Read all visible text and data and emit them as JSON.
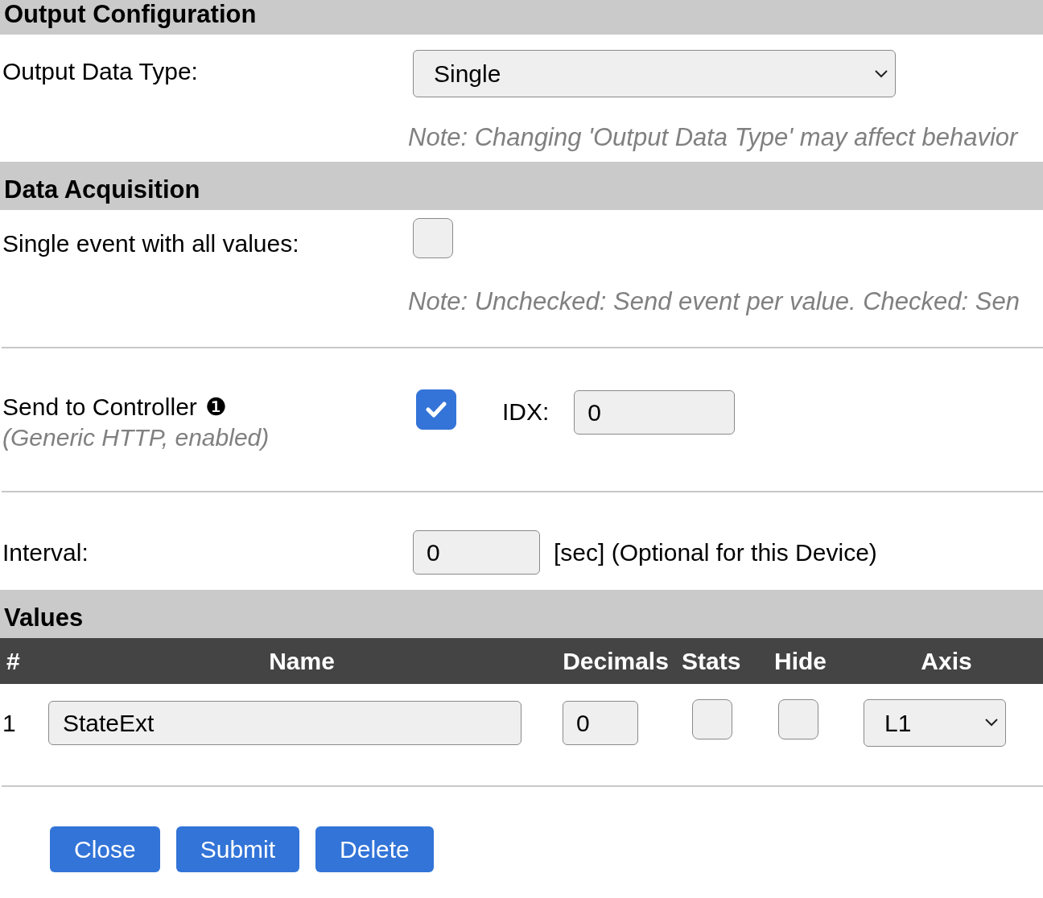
{
  "output_configuration": {
    "title": "Output Configuration",
    "output_data_type": {
      "label": "Output Data Type:",
      "value": "Single",
      "note": "Note: Changing 'Output Data Type' may affect behavior"
    }
  },
  "data_acquisition": {
    "title": "Data Acquisition",
    "single_event": {
      "label": "Single event with all values:",
      "checked": false,
      "note": "Note: Unchecked: Send event per value. Checked: Sen"
    },
    "controller": {
      "label": "Send to Controller",
      "badge": "❶",
      "sublabel": "(Generic HTTP, enabled)",
      "checked": true,
      "idx_label": "IDX:",
      "idx_value": "0"
    },
    "interval": {
      "label": "Interval:",
      "value": "0",
      "suffix": "[sec] (Optional for this Device)"
    }
  },
  "values": {
    "title": "Values",
    "columns": [
      "#",
      "Name",
      "Decimals",
      "Stats",
      "Hide",
      "Axis"
    ],
    "rows": [
      {
        "index": "1",
        "name": "StateExt",
        "decimals": "0",
        "stats": false,
        "hide": false,
        "axis": "L1"
      }
    ]
  },
  "buttons": [
    "Close",
    "Submit",
    "Delete"
  ]
}
